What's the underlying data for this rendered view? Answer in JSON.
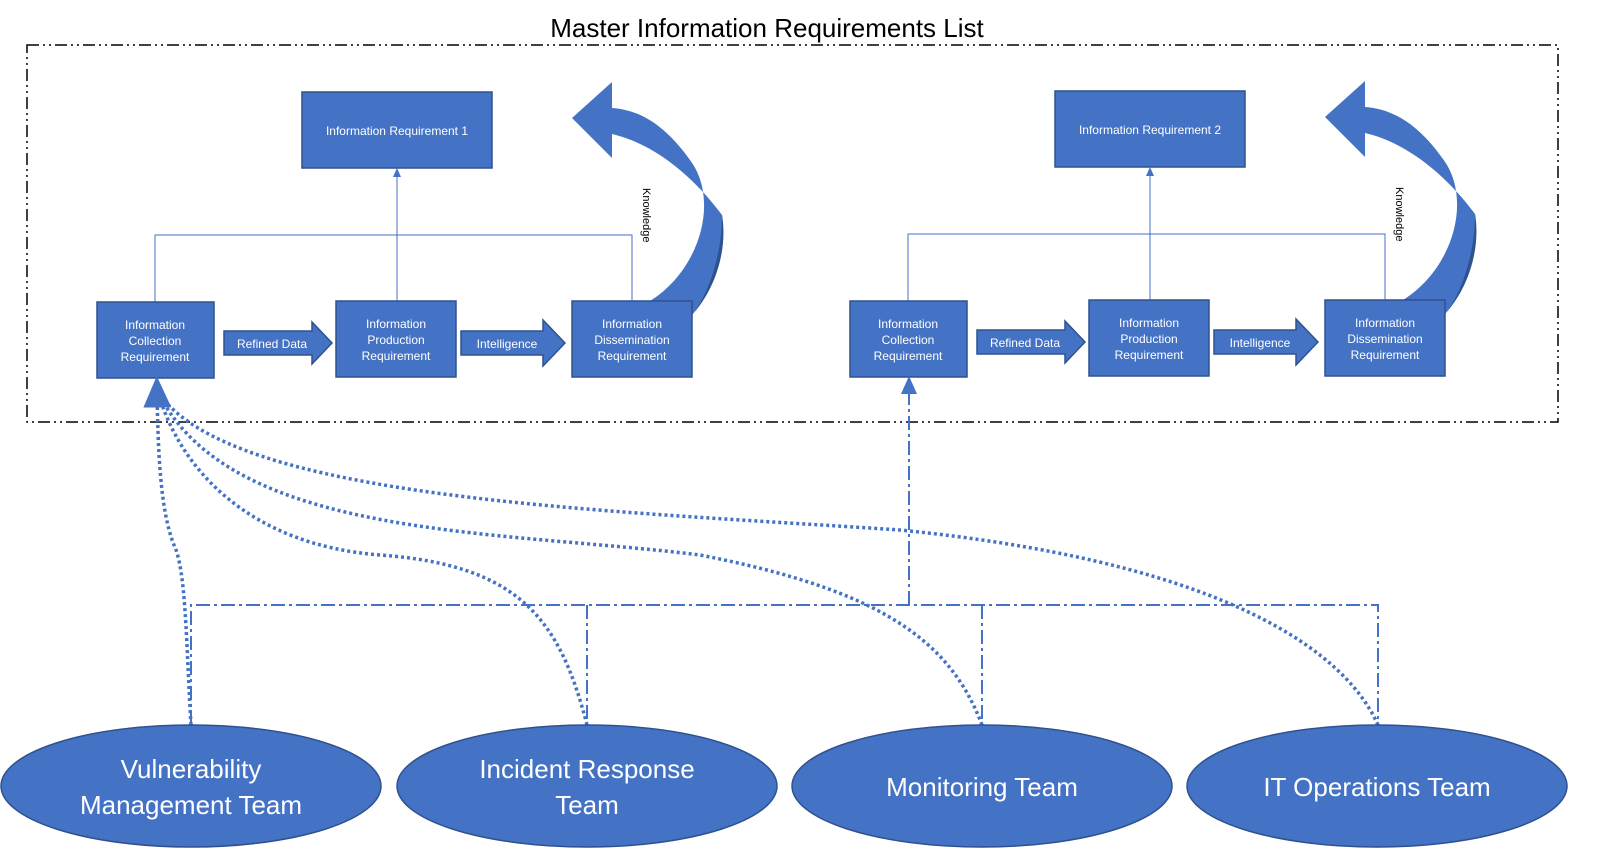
{
  "title": "Master Information Requirements List",
  "colors": {
    "box_fill": "#4472c4",
    "box_border": "#2f528f",
    "boundary": "#000000"
  },
  "groups": [
    {
      "requirement": "Information Requirement 1",
      "collection": [
        "Information",
        "Collection",
        "Requirement"
      ],
      "production": [
        "Information",
        "Production",
        "Requirement"
      ],
      "dissemination": [
        "Information",
        "Dissemination",
        "Requirement"
      ],
      "arrow1": "Refined Data",
      "arrow2": "Intelligence",
      "feedback": "Knowledge"
    },
    {
      "requirement": "Information Requirement 2",
      "collection": [
        "Information",
        "Collection",
        "Requirement"
      ],
      "production": [
        "Information",
        "Production",
        "Requirement"
      ],
      "dissemination": [
        "Information",
        "Dissemination",
        "Requirement"
      ],
      "arrow1": "Refined Data",
      "arrow2": "Intelligence",
      "feedback": "Knowledge"
    }
  ],
  "teams": [
    {
      "lines": [
        "Vulnerability",
        "Management Team"
      ]
    },
    {
      "lines": [
        "Incident Response",
        "Team"
      ]
    },
    {
      "lines": [
        "Monitoring Team"
      ]
    },
    {
      "lines": [
        "IT Operations Team"
      ]
    }
  ]
}
